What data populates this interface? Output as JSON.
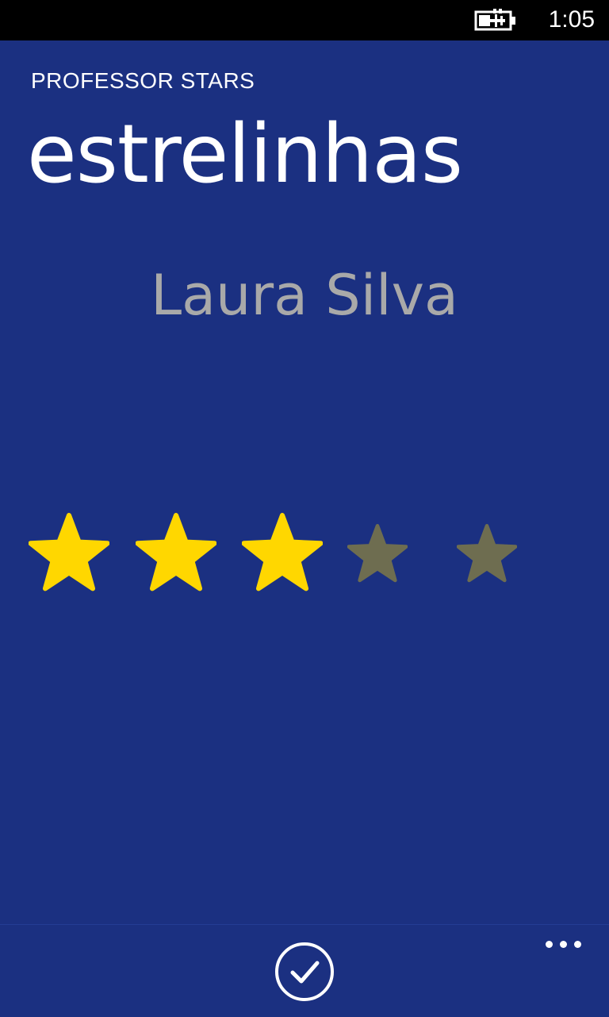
{
  "status_bar": {
    "time": "1:05",
    "battery_icon": "battery-charging-icon"
  },
  "header": {
    "app_title": "PROFESSOR STARS",
    "page_title": "estrelinhas"
  },
  "student": {
    "name": "Laura Silva"
  },
  "rating": {
    "value": 3,
    "max": 5,
    "filled_color": "#FFD700",
    "empty_color": "#6E6D50"
  },
  "app_bar": {
    "confirm_icon": "check-circle-icon",
    "more_icon": "ellipsis-icon"
  },
  "colors": {
    "background": "#1B3081",
    "status_bar": "#000000",
    "name_text": "#A9A9A9"
  }
}
